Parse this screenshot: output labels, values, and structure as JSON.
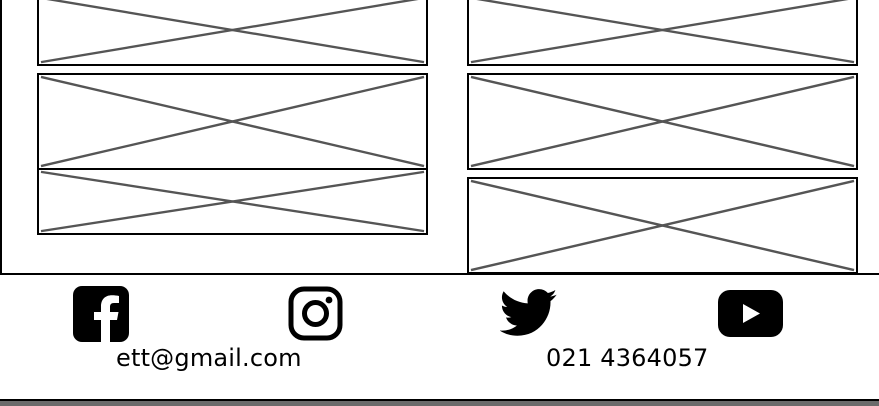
{
  "footer": {
    "social_links": [
      {
        "icon": "facebook-icon"
      },
      {
        "icon": "instagram-icon"
      },
      {
        "icon": "twitter-icon"
      },
      {
        "icon": "youtube-icon"
      }
    ],
    "email": "ett@gmail.com",
    "phone": "021 4364057"
  },
  "colors": {
    "border": "#000000",
    "placeholder_cross": "#555555",
    "background": "#ffffff",
    "bottom_bar": "#6b6b6b"
  }
}
